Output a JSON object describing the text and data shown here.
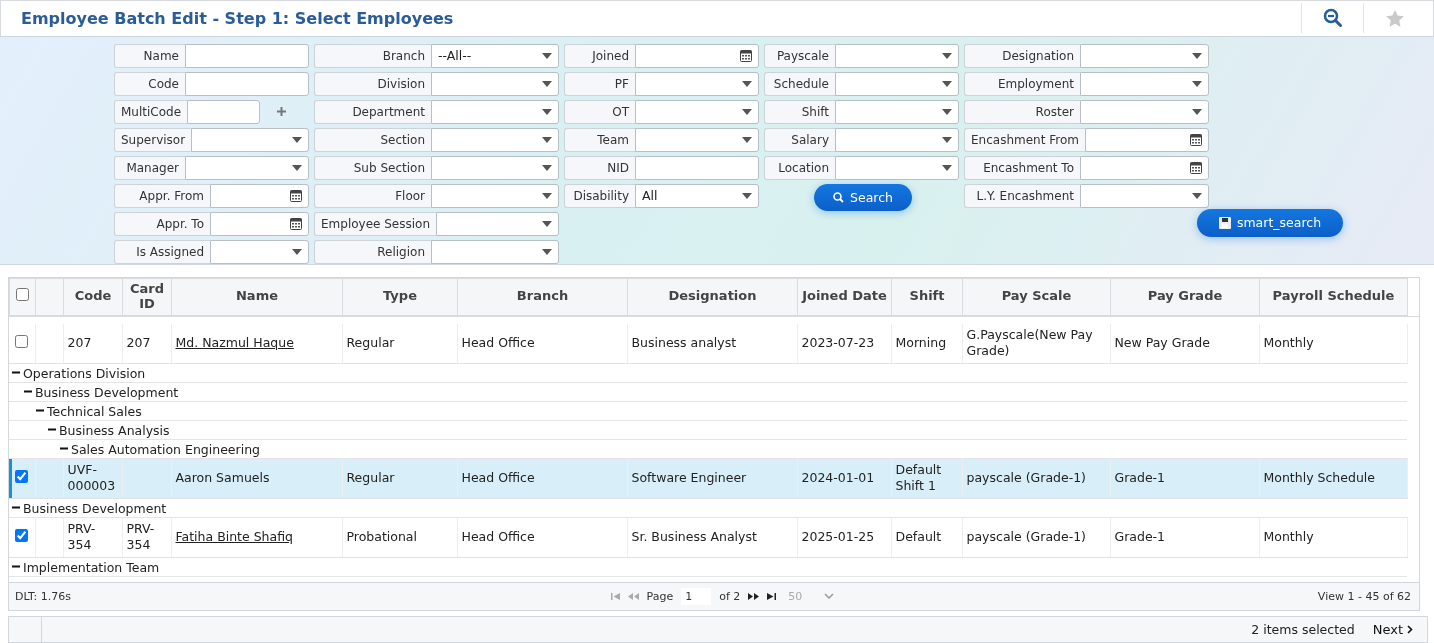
{
  "window": {
    "title": "Employee Batch Edit - Step 1: Select Employees"
  },
  "filters": [
    [
      {
        "kind": "text",
        "label": "Name"
      },
      {
        "kind": "text",
        "label": "Code"
      },
      {
        "kind": "multi",
        "label": "MultiCode"
      },
      {
        "kind": "select",
        "label": "Supervisor"
      },
      {
        "kind": "select",
        "label": "Manager"
      },
      {
        "kind": "date",
        "label": "Appr. From"
      },
      {
        "kind": "date",
        "label": "Appr. To"
      },
      {
        "kind": "select",
        "label": "Is Assigned"
      }
    ],
    [
      {
        "kind": "select",
        "label": "Branch",
        "value": "--All--"
      },
      {
        "kind": "select",
        "label": "Division"
      },
      {
        "kind": "select",
        "label": "Department"
      },
      {
        "kind": "select",
        "label": "Section"
      },
      {
        "kind": "select",
        "label": "Sub Section"
      },
      {
        "kind": "select",
        "label": "Floor"
      },
      {
        "kind": "select",
        "label": "Employee Session"
      },
      {
        "kind": "select",
        "label": "Religion"
      }
    ],
    [
      {
        "kind": "date",
        "label": "Joined"
      },
      {
        "kind": "select",
        "label": "PF"
      },
      {
        "kind": "select",
        "label": "OT"
      },
      {
        "kind": "select",
        "label": "Team"
      },
      {
        "kind": "text",
        "label": "NID"
      },
      {
        "kind": "select",
        "label": "Disability",
        "value": "All"
      }
    ],
    [
      {
        "kind": "select",
        "label": "Payscale"
      },
      {
        "kind": "select",
        "label": "Schedule"
      },
      {
        "kind": "select",
        "label": "Shift"
      },
      {
        "kind": "select",
        "label": "Salary"
      },
      {
        "kind": "select",
        "label": "Location"
      },
      {
        "kind": "search",
        "label": "Search"
      }
    ],
    [
      {
        "kind": "select",
        "label": "Designation"
      },
      {
        "kind": "select",
        "label": "Employment"
      },
      {
        "kind": "select",
        "label": "Roster"
      },
      {
        "kind": "date",
        "label": "Encashment From"
      },
      {
        "kind": "date",
        "label": "Encashment To"
      },
      {
        "kind": "select",
        "label": "L.Y. Encashment"
      },
      {
        "kind": "save",
        "label": "smart_search"
      }
    ]
  ],
  "table": {
    "select_all": {
      "checked": false
    },
    "columns": [
      {
        "label": "Code"
      },
      {
        "label": "Card ID"
      },
      {
        "label": "Name"
      },
      {
        "label": "Type"
      },
      {
        "label": "Branch"
      },
      {
        "label": "Designation"
      },
      {
        "label": "Joined Date"
      },
      {
        "label": "Shift"
      },
      {
        "label": "Pay Scale"
      },
      {
        "label": "Pay Grade"
      },
      {
        "label": "Payroll Schedule"
      }
    ],
    "rows": [
      {
        "kind": "employee",
        "checked": false,
        "highlighted": false,
        "link": true,
        "code": "207",
        "card_id": "207",
        "name": "Md. Nazmul Haque",
        "type": "Regular",
        "branch": "Head Office",
        "designation": "Business analyst",
        "joined_date": "2023-07-23",
        "shift": "Morning",
        "pay_scale": "G.Payscale(New Pay Grade)",
        "pay_grade": "New Pay Grade",
        "payroll_schedule": "Monthly"
      },
      {
        "kind": "group",
        "label": "Operations Division",
        "expanded": true,
        "children": [
          {
            "kind": "group",
            "label": "Business Development",
            "expanded": true,
            "children": [
              {
                "kind": "group",
                "label": "Technical Sales",
                "expanded": true,
                "children": [
                  {
                    "kind": "group",
                    "label": "Business Analysis",
                    "expanded": true,
                    "children": [
                      {
                        "kind": "group",
                        "label": "Sales Automation Engineering",
                        "expanded": true,
                        "children": [
                          {
                            "kind": "employee",
                            "checked": true,
                            "highlighted": true,
                            "link": false,
                            "code": "UVF-000003",
                            "name": "Aaron Samuels",
                            "type": "Regular",
                            "branch": "Head Office",
                            "designation": "Software Engineer",
                            "joined_date": "2024-01-01",
                            "shift": "Default Shift 1",
                            "pay_scale": "payscale (Grade-1)",
                            "pay_grade": "Grade-1",
                            "payroll_schedule": "Monthly Schedule"
                          }
                        ]
                      }
                    ]
                  }
                ]
              }
            ]
          }
        ]
      },
      {
        "kind": "group",
        "label": "Business Development",
        "expanded": true,
        "children": [
          {
            "kind": "employee",
            "checked": true,
            "highlighted": false,
            "link": true,
            "code": "PRV-354",
            "card_id": "PRV-354",
            "name": "Fatiha Binte Shafiq",
            "type": "Probational",
            "branch": "Head Office",
            "designation": "Sr. Business Analyst",
            "joined_date": "2025-01-25",
            "shift": "Default",
            "pay_scale": "payscale (Grade-1)",
            "pay_grade": "Grade-1",
            "payroll_schedule": "Monthly"
          }
        ]
      },
      {
        "kind": "group",
        "label": "Implementation Team",
        "expanded": true
      }
    ]
  },
  "pager": {
    "load_time": "DLT: 1.76s",
    "page_label": "Page",
    "page": "1",
    "page_total": "of 2",
    "page_size": "50",
    "view": "View 1 - 45 of 62"
  },
  "footer": {
    "selection": "2 items selected",
    "next": "Next"
  }
}
